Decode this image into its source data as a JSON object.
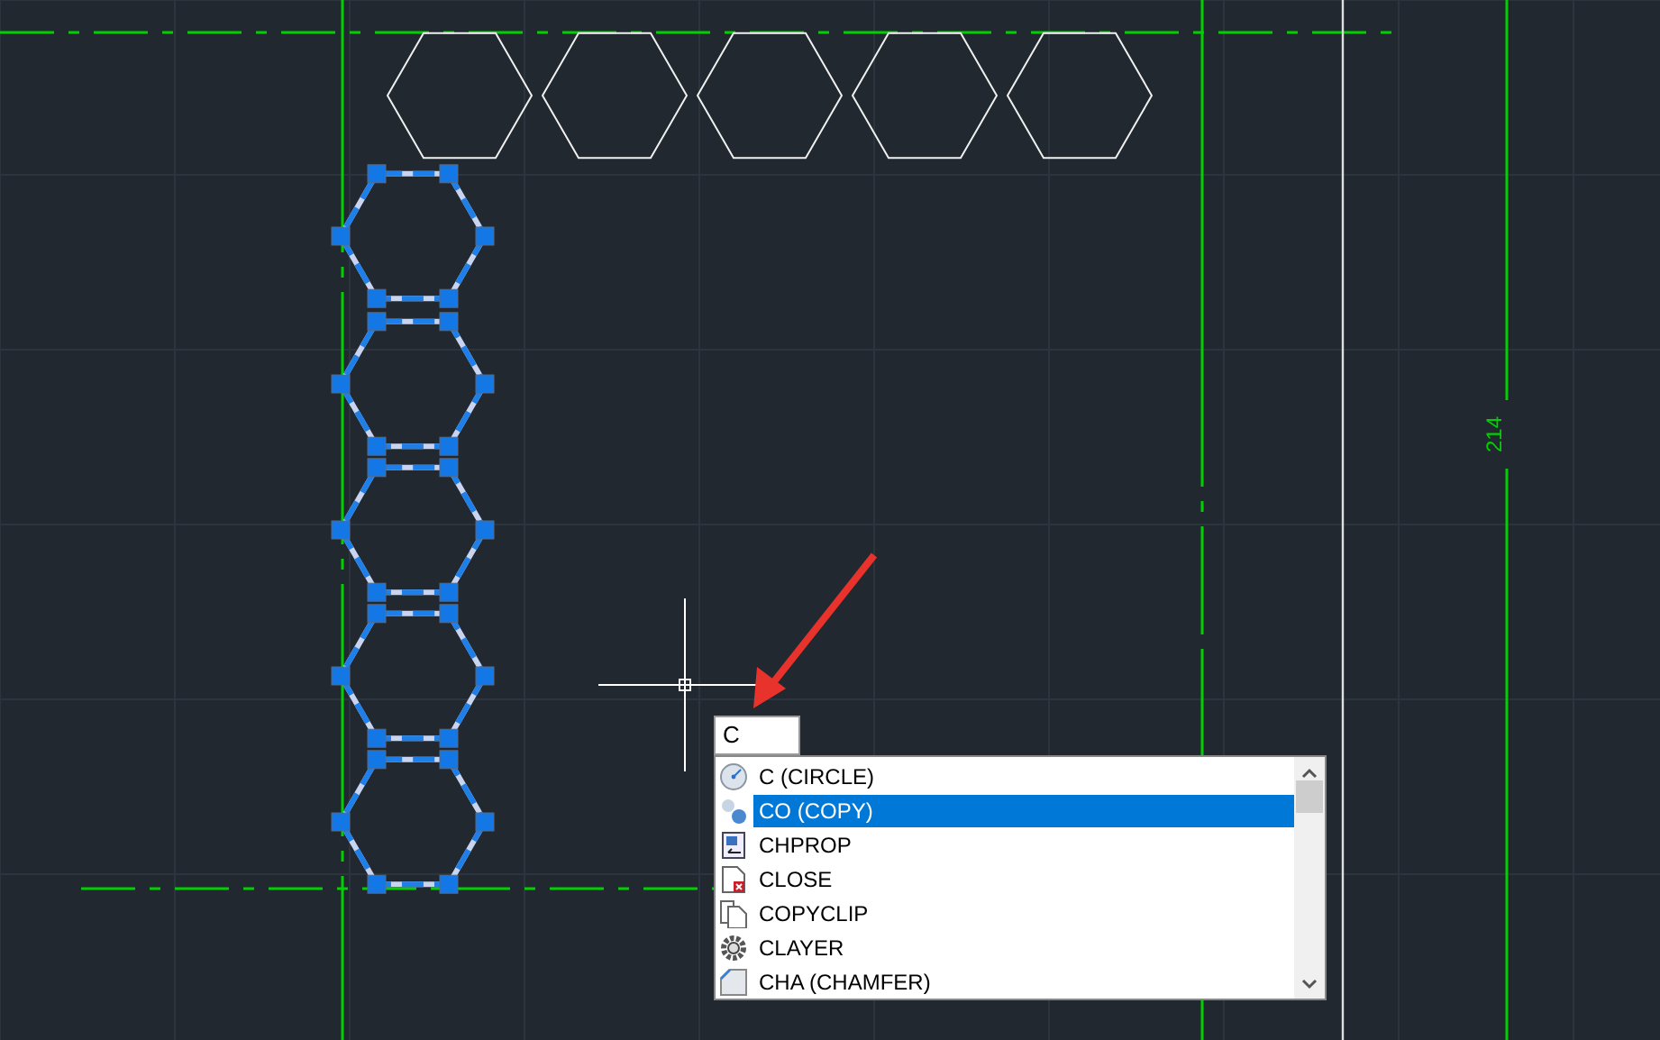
{
  "drawing": {
    "dimension_text": "214"
  },
  "command_input": {
    "value": "C"
  },
  "suggestions": [
    {
      "label": "C (CIRCLE)",
      "kind": "circle",
      "selected": false
    },
    {
      "label": "CO (COPY)",
      "kind": "copy",
      "selected": true
    },
    {
      "label": "CHPROP",
      "kind": "properties",
      "selected": false
    },
    {
      "label": "CLOSE",
      "kind": "close",
      "selected": false
    },
    {
      "label": "COPYCLIP",
      "kind": "clipboard",
      "selected": false
    },
    {
      "label": "CLAYER",
      "kind": "gear",
      "selected": false
    },
    {
      "label": "CHA (CHAMFER)",
      "kind": "chamfer",
      "selected": false
    }
  ]
}
